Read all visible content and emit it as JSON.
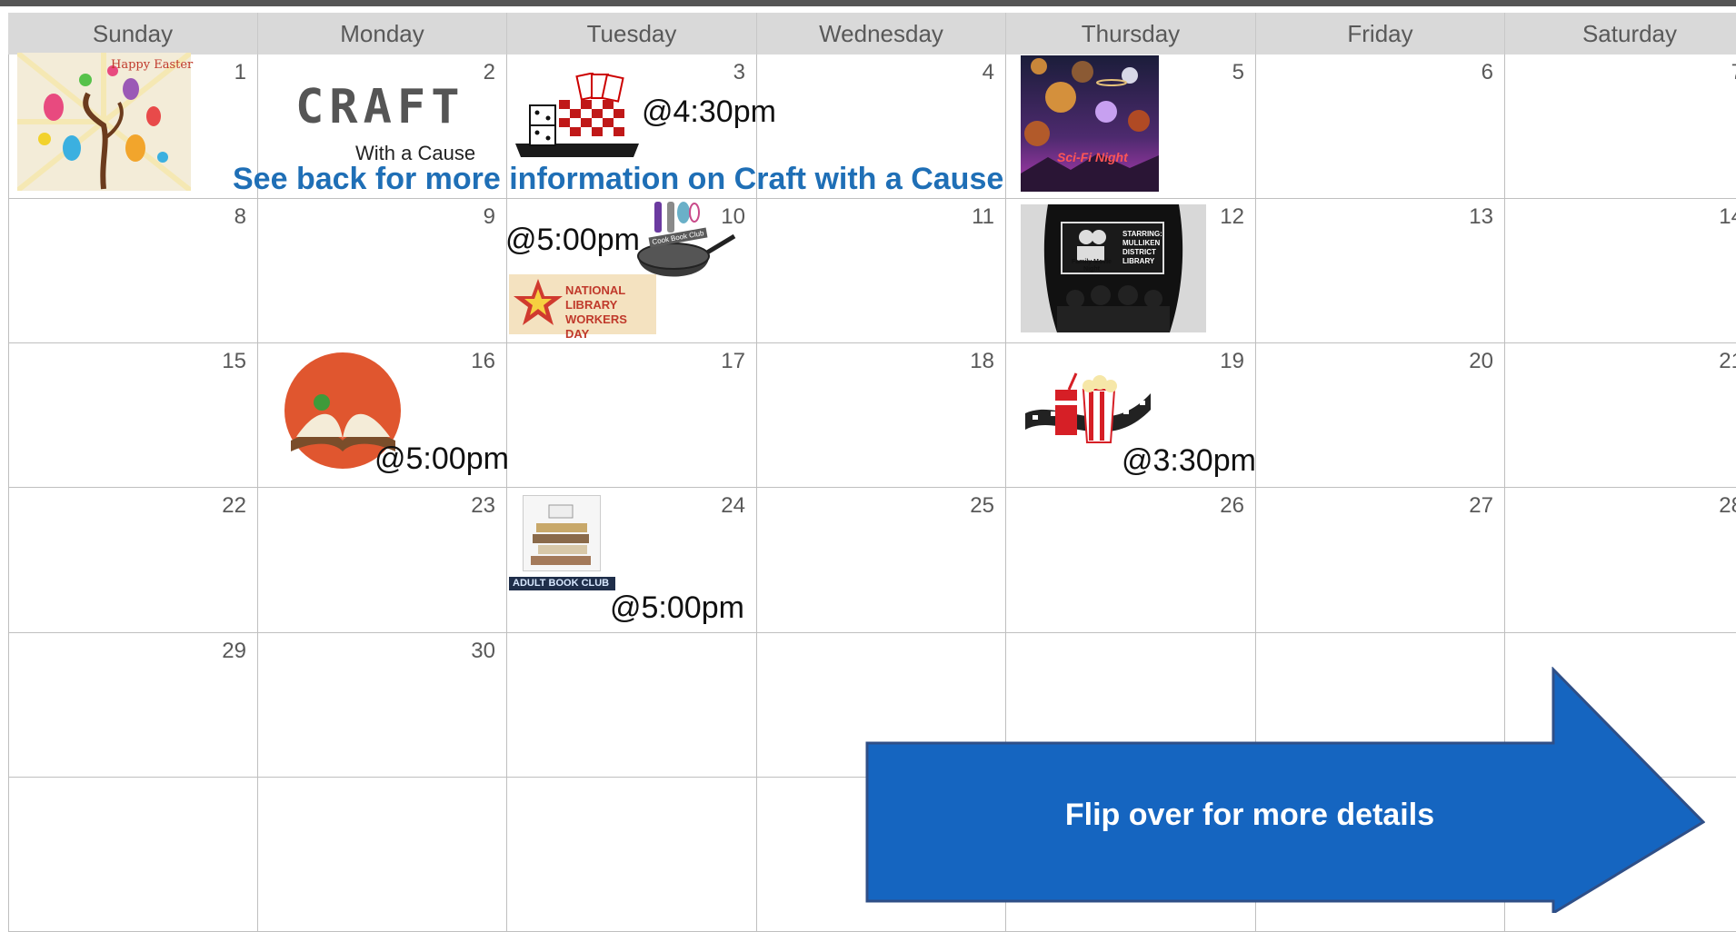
{
  "weekdays": [
    "Sunday",
    "Monday",
    "Tuesday",
    "Wednesday",
    "Thursday",
    "Friday",
    "Saturday"
  ],
  "days": {
    "d1": "1",
    "d2": "2",
    "d3": "3",
    "d4": "4",
    "d5": "5",
    "d6": "6",
    "d7": "7",
    "d8": "8",
    "d9": "9",
    "d10": "10",
    "d11": "11",
    "d12": "12",
    "d13": "13",
    "d14": "14",
    "d15": "15",
    "d16": "16",
    "d17": "17",
    "d18": "18",
    "d19": "19",
    "d20": "20",
    "d21": "21",
    "d22": "22",
    "d23": "23",
    "d24": "24",
    "d25": "25",
    "d26": "26",
    "d27": "27",
    "d28": "28",
    "d29": "29",
    "d30": "30"
  },
  "events": {
    "easter_text": "Happy Easter",
    "craft_title": "CRAFT",
    "craft_subtitle": "With a Cause",
    "craft_note": "See back for more information on Craft with a Cause",
    "game_time": "@4:30pm",
    "scifi_text": "Sci-Fi Night",
    "cookbook_time": "@5:00pm",
    "cookbook_label": "Cook Book Club",
    "library_workers": "NATIONAL LIBRARY WORKERS DAY",
    "movie_night_text": "STARRING: MULLIKEN DISTRICT LIBRARY",
    "movie_night_label": "Family Movie Night",
    "story_time": "@5:00pm",
    "movie_club_time": "@3:30pm",
    "book_club_label": "ADULT BOOK CLUB",
    "book_club_time": "@5:00pm"
  },
  "callout": {
    "label": "Flip over for more details",
    "color": "#1565c0"
  }
}
